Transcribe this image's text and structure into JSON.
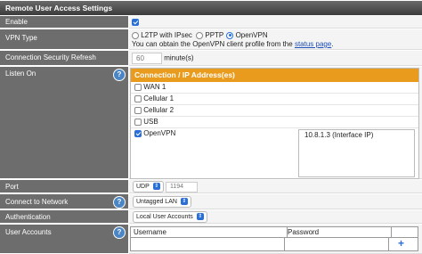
{
  "title": "Remote User Access Settings",
  "enable": {
    "label": "Enable",
    "checked": true
  },
  "vpn_type": {
    "label": "VPN Type",
    "options": [
      "L2TP with IPsec",
      "PPTP",
      "OpenVPN"
    ],
    "selected": "OpenVPN",
    "note": "You can obtain the OpenVPN client profile from the",
    "link": "status page",
    "note_end": "."
  },
  "refresh": {
    "label": "Connection Security Refresh",
    "placeholder": "60",
    "unit": "minute(s)"
  },
  "listen_on": {
    "label": "Listen On",
    "table_header": "Connection / IP Address(es)",
    "rows": [
      {
        "name": "WAN 1",
        "checked": false
      },
      {
        "name": "Cellular 1",
        "checked": false
      },
      {
        "name": "Cellular 2",
        "checked": false
      },
      {
        "name": "USB",
        "checked": false
      },
      {
        "name": "OpenVPN",
        "checked": true
      }
    ],
    "ip": "10.8.1.3 (Interface IP)"
  },
  "port": {
    "label": "Port",
    "protocol": "UDP",
    "placeholder": "1194"
  },
  "network": {
    "label": "Connect to Network",
    "value": "Untagged LAN"
  },
  "auth": {
    "label": "Authentication",
    "value": "Local User Accounts"
  },
  "accounts": {
    "label": "User Accounts",
    "col_username": "Username",
    "col_password": "Password",
    "add": "+"
  },
  "help_symbol": "?",
  "colors": {
    "header": "#555555",
    "label_bg": "#6d6d6d",
    "table_header": "#e99b1d",
    "accent": "#2a6fd6"
  }
}
